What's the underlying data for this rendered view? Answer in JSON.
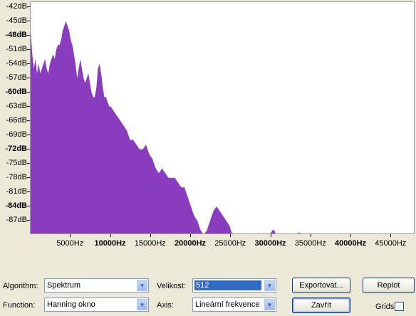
{
  "chart_data": {
    "type": "area",
    "title": "",
    "xlabel": "",
    "ylabel": "",
    "color": "#8a3cbf",
    "xlim": [
      0,
      48000
    ],
    "ylim": [
      -90,
      -41
    ],
    "y_ticks": [
      {
        "label": "-42dB",
        "value": -42,
        "bold": false
      },
      {
        "label": "-45dB",
        "value": -45,
        "bold": false
      },
      {
        "label": "-48dB",
        "value": -48,
        "bold": true
      },
      {
        "label": "-51dB",
        "value": -51,
        "bold": false
      },
      {
        "label": "-54dB",
        "value": -54,
        "bold": false
      },
      {
        "label": "-57dB",
        "value": -57,
        "bold": false
      },
      {
        "label": "-60dB",
        "value": -60,
        "bold": true
      },
      {
        "label": "-63dB",
        "value": -63,
        "bold": false
      },
      {
        "label": "-66dB",
        "value": -66,
        "bold": false
      },
      {
        "label": "-69dB",
        "value": -69,
        "bold": false
      },
      {
        "label": "-72dB",
        "value": -72,
        "bold": true
      },
      {
        "label": "-75dB",
        "value": -75,
        "bold": false
      },
      {
        "label": "-78dB",
        "value": -78,
        "bold": false
      },
      {
        "label": "-81dB",
        "value": -81,
        "bold": false
      },
      {
        "label": "-84dB",
        "value": -84,
        "bold": true
      },
      {
        "label": "-87dB",
        "value": -87,
        "bold": false
      }
    ],
    "x_ticks": [
      {
        "label": "5000Hz",
        "value": 5000,
        "bold": false
      },
      {
        "label": "10000Hz",
        "value": 10000,
        "bold": true
      },
      {
        "label": "15000Hz",
        "value": 15000,
        "bold": false
      },
      {
        "label": "20000Hz",
        "value": 20000,
        "bold": true
      },
      {
        "label": "25000Hz",
        "value": 25000,
        "bold": false
      },
      {
        "label": "30000Hz",
        "value": 30000,
        "bold": true
      },
      {
        "label": "35000Hz",
        "value": 35000,
        "bold": false
      },
      {
        "label": "40000Hz",
        "value": 40000,
        "bold": true
      },
      {
        "label": "45000Hz",
        "value": 45000,
        "bold": false
      }
    ],
    "x": [
      0,
      200,
      400,
      600,
      800,
      1000,
      1200,
      1400,
      1600,
      1800,
      2000,
      2200,
      2400,
      2600,
      2800,
      3000,
      3200,
      3400,
      3600,
      3800,
      4000,
      4200,
      4400,
      4600,
      4800,
      5000,
      5200,
      5400,
      5600,
      5800,
      6000,
      6200,
      6400,
      6600,
      6800,
      7000,
      7200,
      7400,
      7600,
      7800,
      8000,
      8200,
      8400,
      8600,
      8800,
      9000,
      9200,
      9400,
      9600,
      9800,
      10000,
      10400,
      10800,
      11200,
      11600,
      12000,
      12400,
      12800,
      13200,
      13600,
      14000,
      14400,
      14800,
      15200,
      15600,
      16000,
      16400,
      16800,
      17200,
      17600,
      18000,
      18400,
      18800,
      19200,
      19600,
      20000,
      20400,
      20800,
      21200,
      21600,
      22000,
      22400,
      22800,
      23200,
      23600,
      24000,
      24400,
      24800,
      25200,
      25600,
      26000,
      26500,
      27000,
      28000,
      29000,
      29800,
      30200,
      30400,
      30600,
      31000,
      32000,
      33000,
      33500,
      33800,
      34200,
      35000,
      40000,
      48000
    ],
    "values": [
      -47,
      -52,
      -55,
      -53,
      -56,
      -54,
      -56,
      -55,
      -54,
      -53,
      -55,
      -56,
      -54,
      -53,
      -52,
      -53,
      -51,
      -50,
      -50,
      -49,
      -47,
      -46,
      -45,
      -46,
      -47,
      -49,
      -50,
      -52,
      -54,
      -57,
      -55,
      -53,
      -55,
      -57,
      -58,
      -57,
      -56,
      -58,
      -60,
      -61,
      -61,
      -59,
      -55,
      -54,
      -56,
      -59,
      -61,
      -61,
      -62,
      -63,
      -63,
      -64,
      -65,
      -66,
      -67,
      -68,
      -70,
      -70,
      -71,
      -72,
      -72,
      -71,
      -73,
      -74,
      -76,
      -77,
      -76,
      -77,
      -78,
      -78,
      -78,
      -79,
      -80,
      -80,
      -82,
      -84,
      -86,
      -87,
      -89,
      -90,
      -89,
      -87,
      -85,
      -84,
      -85,
      -86,
      -87,
      -88,
      -90,
      -90,
      -90,
      -90,
      -90,
      -90,
      -90,
      -90,
      -89,
      -89,
      -90,
      -90,
      -90,
      -90,
      -89.5,
      -90,
      -90,
      -90,
      -90,
      -90
    ]
  },
  "controls": {
    "algorithm_label": "Algorithm:",
    "algorithm_value": "Spektrum",
    "size_label": "Velikost:",
    "size_value": "512",
    "function_label": "Function:",
    "function_value": "Hanning okno",
    "axis_label": "Axis:",
    "axis_value": "Lineární frekvence",
    "export_button": "Exportovat...",
    "replot_button": "Replot",
    "close_button": "Zavřít",
    "grids_label": "Grids",
    "grids_checked": false,
    "dropdown_arrow": "▼"
  }
}
